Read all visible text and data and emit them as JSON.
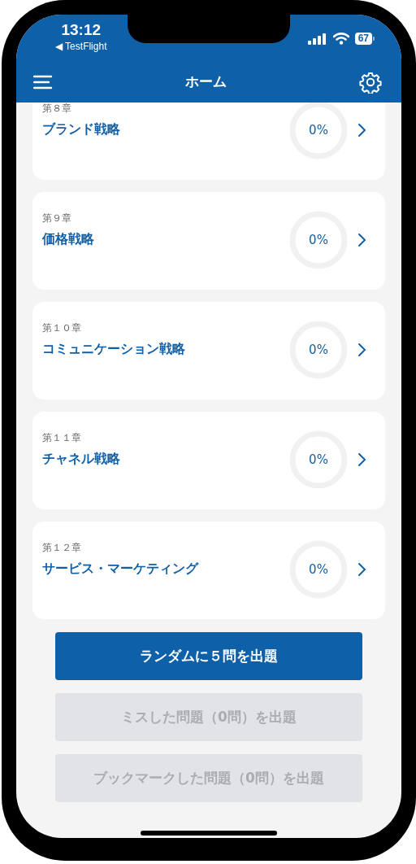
{
  "status_bar": {
    "time": "13:12",
    "back_app": "◀ TestFlight",
    "battery": "67"
  },
  "nav_bar": {
    "title": "ホーム"
  },
  "chapters": [
    {
      "number": "第８章",
      "title": "ブランド戦略",
      "progress": "0%",
      "level": 0
    },
    {
      "number": "第９章",
      "title": "価格戦略",
      "progress": "0%",
      "level": 0
    },
    {
      "number": "第１０章",
      "title": "コミュニケーション戦略",
      "progress": "0%",
      "level": 0
    },
    {
      "number": "第１１章",
      "title": "チャネル戦略",
      "progress": "0%",
      "level": 0
    },
    {
      "number": "第１２章",
      "title": "サービス・マーケティング",
      "progress": "0%",
      "level": 0
    }
  ],
  "buttons": [
    {
      "label": "ランダムに５問を出題",
      "disabled": false
    },
    {
      "label": "ミスした問題（0問）を出題",
      "disabled": true
    },
    {
      "label": "ブックマークした問題（0問）を出題",
      "disabled": true
    }
  ]
}
